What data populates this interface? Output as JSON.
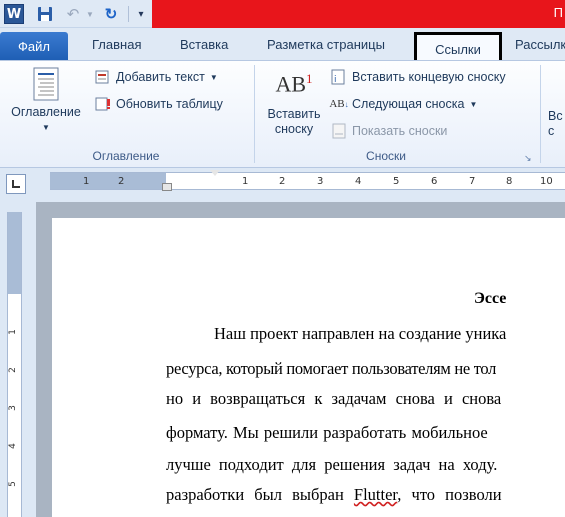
{
  "qat": {
    "word_icon_letter": "W",
    "title_fragment": "П"
  },
  "tabs": [
    "Файл",
    "Главная",
    "Вставка",
    "Разметка страницы",
    "Ссылки",
    "Рассылк"
  ],
  "ribbon": {
    "toc_group": {
      "toc_button": "Оглавление",
      "add_text": "Добавить текст",
      "update_table": "Обновить таблицу",
      "label": "Оглавление"
    },
    "footnotes_group": {
      "insert_footnote_line1": "Вставить",
      "insert_footnote_line2": "сноску",
      "ab_icon_text": "AB",
      "ab_superscript": "1",
      "insert_endnote": "Вставить концевую сноску",
      "next_footnote": "Следующая сноска",
      "show_notes": "Показать сноски",
      "label": "Сноски"
    },
    "partial_button_line1": "Вс",
    "partial_button_line2": "с"
  },
  "ruler": {
    "ticks": [
      "1",
      "2",
      "1",
      "2",
      "3",
      "4",
      "5",
      "6",
      "7",
      "8",
      "9",
      "10"
    ],
    "vticks": [
      "1",
      "2",
      "3",
      "4",
      "5"
    ]
  },
  "document": {
    "title": "Эссе",
    "lines": [
      "Наш проект направлен на создание уника",
      "ресурса, который помогает пользователям не тол",
      "но и возвращаться к задачам снова и снова",
      "формату. Мы решили разработать мобильное",
      "лучше подходит для решения задач на ходу.",
      "разработки был выбран"
    ],
    "flutter_word": "Flutter",
    "last_line_tail": ", что позволи"
  },
  "colors": {
    "title_bar": "#e8151b",
    "file_tab": "#2a6ac2",
    "ribbon_bg": "#f3f7fd"
  }
}
